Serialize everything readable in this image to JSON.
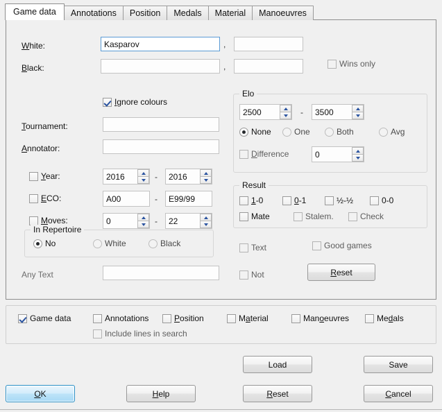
{
  "tabs": [
    {
      "label": "Game data",
      "active": true
    },
    {
      "label": "Annotations",
      "active": false
    },
    {
      "label": "Position",
      "active": false
    },
    {
      "label": "Medals",
      "active": false
    },
    {
      "label": "Material",
      "active": false
    },
    {
      "label": "Manoeuvres",
      "active": false
    }
  ],
  "players": {
    "white_label": "White:",
    "white_value": "Kasparov",
    "white_placeholder": "",
    "white_second_value": "",
    "black_label": "Black:",
    "black_value": "",
    "black_second_value": "",
    "comma": ",",
    "ignore_colours_label": "Ignore colours",
    "ignore_colours_checked": true,
    "wins_only_label": "Wins only",
    "wins_only_checked": false
  },
  "details": {
    "tournament_label": "Tournament:",
    "tournament_value": "",
    "annotator_label": "Annotator:",
    "annotator_value": "",
    "year_label": "Year:",
    "year_checked": false,
    "year_from": "2016",
    "year_to": "2016",
    "eco_label": "ECO:",
    "eco_checked": false,
    "eco_from": "A00",
    "eco_to": "E99/99",
    "moves_label": "Moves:",
    "moves_checked": false,
    "moves_from": "0",
    "moves_to": "22",
    "range_separator": "-"
  },
  "elo": {
    "caption": "Elo",
    "from": "2500",
    "to": "3500",
    "separator": "-",
    "options": [
      {
        "label": "None",
        "selected": true
      },
      {
        "label": "One",
        "selected": false
      },
      {
        "label": "Both",
        "selected": false
      },
      {
        "label": "Avg",
        "selected": false
      }
    ],
    "difference_label": "Difference",
    "difference_checked": false,
    "difference_value": "0"
  },
  "result": {
    "caption": "Result",
    "items": [
      {
        "label": "1-0",
        "checked": false
      },
      {
        "label": "0-1",
        "checked": false
      },
      {
        "label": "½-½",
        "checked": false
      },
      {
        "label": "0-0",
        "checked": false
      },
      {
        "label": "Mate",
        "checked": false
      },
      {
        "label": "Stalem.",
        "checked": false
      },
      {
        "label": "Check",
        "checked": false
      }
    ]
  },
  "repertoire": {
    "caption": "In Repertoire",
    "options": [
      {
        "label": "No",
        "selected": true
      },
      {
        "label": "White",
        "selected": false
      },
      {
        "label": "Black",
        "selected": false
      }
    ]
  },
  "anytext": {
    "label": "Any Text",
    "value": ""
  },
  "flags": {
    "text_label": "Text",
    "text_checked": false,
    "good_games_label": "Good games",
    "good_games_checked": false,
    "not_label": "Not",
    "not_checked": false,
    "reset_label": "Reset"
  },
  "search_areas": {
    "items": [
      {
        "label": "Game data",
        "checked": true
      },
      {
        "label": "Annotations",
        "checked": false
      },
      {
        "label": "Position",
        "checked": false
      },
      {
        "label": "Material",
        "checked": false
      },
      {
        "label": "Manoeuvres",
        "checked": false
      },
      {
        "label": "Medals",
        "checked": false
      }
    ],
    "include_lines_label": "Include lines in search",
    "include_lines_checked": false
  },
  "buttons": {
    "load": "Load",
    "save": "Save",
    "reset": "Reset",
    "cancel": "Cancel",
    "ok": "OK",
    "help": "Help"
  },
  "colors": {
    "accent": "#2a53a0",
    "default_button": "#2a8fc6",
    "focus_border": "#5b9bd5",
    "window_bg": "#f0f0f0"
  }
}
